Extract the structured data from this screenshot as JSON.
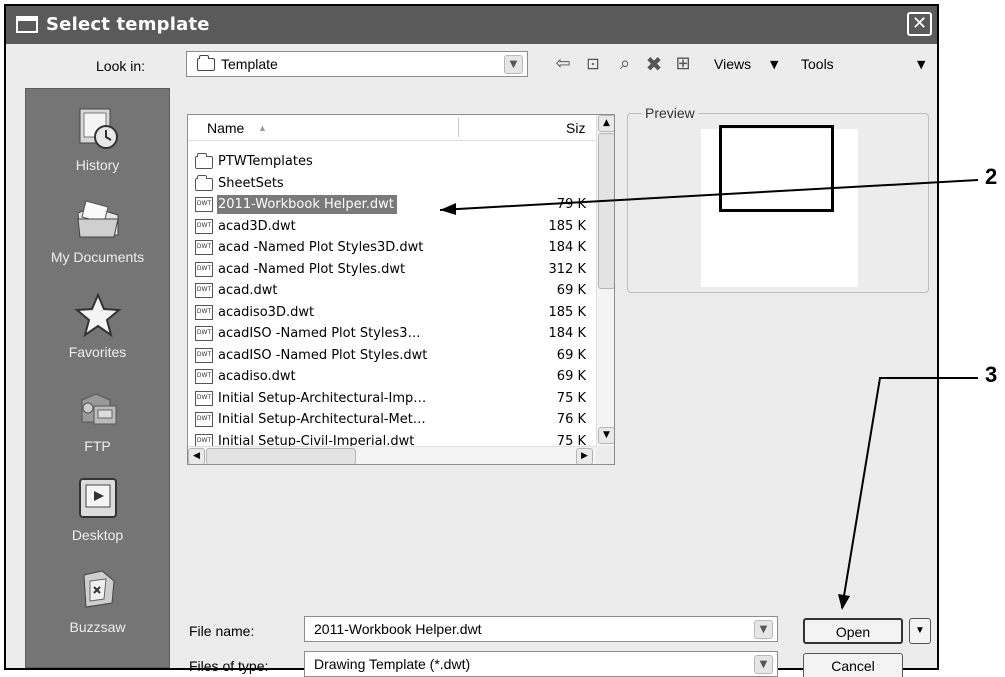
{
  "dialog": {
    "title": "Select template",
    "close_glyph": "✕"
  },
  "look_in": {
    "label": "Look in:",
    "value": "Template"
  },
  "toolbar": {
    "icons": [
      "back-icon",
      "up-folder-icon",
      "search-web-icon",
      "delete-icon",
      "new-folder-icon"
    ],
    "views_label": "Views",
    "tools_label": "Tools"
  },
  "places": [
    {
      "label": "History",
      "icon": "history-icon"
    },
    {
      "label": "My Documents",
      "icon": "my-documents-icon"
    },
    {
      "label": "Favorites",
      "icon": "favorites-icon"
    },
    {
      "label": "FTP",
      "icon": "ftp-icon"
    },
    {
      "label": "Desktop",
      "icon": "desktop-icon"
    },
    {
      "label": "Buzzsaw",
      "icon": "buzzsaw-icon"
    }
  ],
  "file_list": {
    "columns": {
      "name": "Name",
      "size": "Siz"
    },
    "rows": [
      {
        "name": "PTWTemplates",
        "size": "",
        "type": "folder"
      },
      {
        "name": "SheetSets",
        "size": "",
        "type": "folder"
      },
      {
        "name": "2011-Workbook Helper.dwt",
        "size": "79 K",
        "type": "dwt",
        "selected": true
      },
      {
        "name": "acad3D.dwt",
        "size": "185 K",
        "type": "dwt"
      },
      {
        "name": "acad -Named Plot Styles3D.dwt",
        "size": "184 K",
        "type": "dwt"
      },
      {
        "name": "acad -Named Plot Styles.dwt",
        "size": "312 K",
        "type": "dwt"
      },
      {
        "name": "acad.dwt",
        "size": "69 K",
        "type": "dwt"
      },
      {
        "name": "acadiso3D.dwt",
        "size": "185 K",
        "type": "dwt"
      },
      {
        "name": "acadISO -Named Plot Styles3…",
        "size": "184 K",
        "type": "dwt"
      },
      {
        "name": "acadISO -Named Plot Styles.dwt",
        "size": "69 K",
        "type": "dwt"
      },
      {
        "name": "acadiso.dwt",
        "size": "69 K",
        "type": "dwt"
      },
      {
        "name": "Initial Setup-Architectural-Imp…",
        "size": "75 K",
        "type": "dwt"
      },
      {
        "name": "Initial Setup-Architectural-Met…",
        "size": "76 K",
        "type": "dwt"
      },
      {
        "name": "Initial Setup-Civil-Imperial.dwt",
        "size": "75 K",
        "type": "dwt"
      }
    ],
    "file_icon_text": "DWT"
  },
  "preview": {
    "label": "Preview"
  },
  "file_name": {
    "label": "File name:",
    "value": "2011-Workbook Helper.dwt"
  },
  "files_of_type": {
    "label": "Files of type:",
    "value": "Drawing Template (*.dwt)"
  },
  "buttons": {
    "open": "Open",
    "cancel": "Cancel"
  },
  "callouts": [
    "2",
    "3"
  ],
  "colors": {
    "titlebar": "#5a5a5a",
    "places_bar": "#757575",
    "selection": "#7a7a7a"
  }
}
